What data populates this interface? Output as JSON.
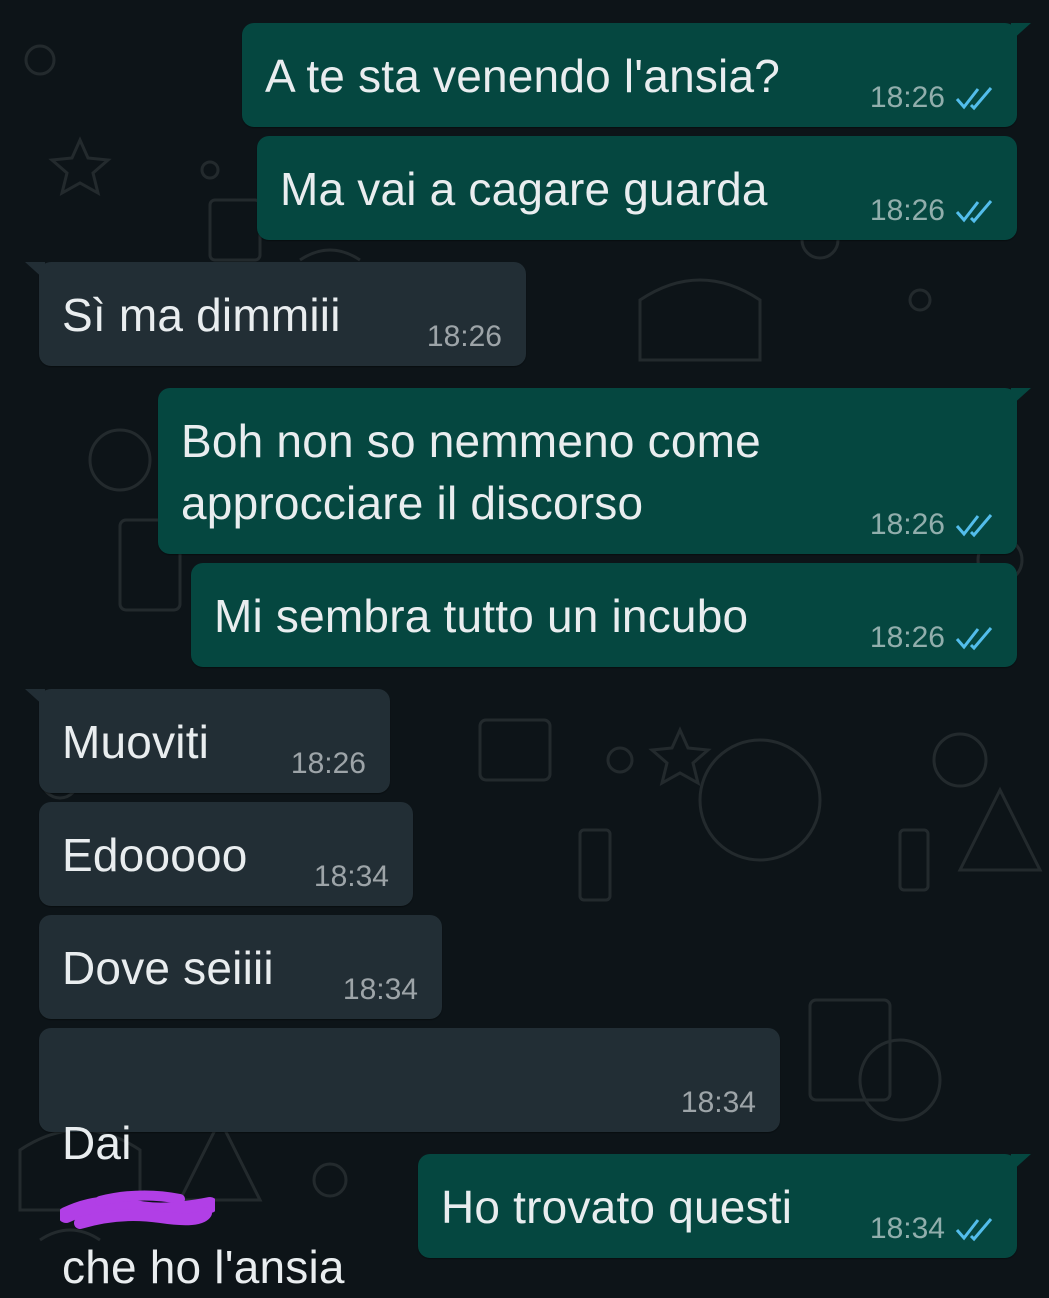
{
  "colors": {
    "background": "#0d1418",
    "outgoing_bubble": "#054740",
    "incoming_bubble": "#222e35",
    "text": "#e9edef",
    "read_ticks": "#53bdeb",
    "redaction": "#b13fe6"
  },
  "messages": [
    {
      "direction": "out",
      "text": "A te sta venendo l'ansia?",
      "time": "18:26",
      "status": "read",
      "status_icon": "double-check-icon"
    },
    {
      "direction": "out",
      "text": "Ma vai a cagare guarda",
      "time": "18:26",
      "status": "read",
      "status_icon": "double-check-icon"
    },
    {
      "direction": "in",
      "text": "Sì ma dimmiii",
      "time": "18:26"
    },
    {
      "direction": "out",
      "text": "Boh non so nemmeno come\napprocciare il discorso",
      "time": "18:26",
      "status": "read",
      "status_icon": "double-check-icon"
    },
    {
      "direction": "out",
      "text": "Mi sembra tutto un incubo",
      "time": "18:26",
      "status": "read",
      "status_icon": "double-check-icon"
    },
    {
      "direction": "in",
      "text": "Muoviti",
      "time": "18:26"
    },
    {
      "direction": "in",
      "text": "Edooooo",
      "time": "18:34"
    },
    {
      "direction": "in",
      "text": "Dove seiiii",
      "time": "18:34"
    },
    {
      "direction": "in",
      "text_before": "Dai",
      "text_after": "che ho l'ansia",
      "time": "18:34",
      "redacted": true
    },
    {
      "direction": "out",
      "text": "Ho trovato questi",
      "time": "18:34",
      "status": "read",
      "status_icon": "double-check-icon"
    }
  ]
}
